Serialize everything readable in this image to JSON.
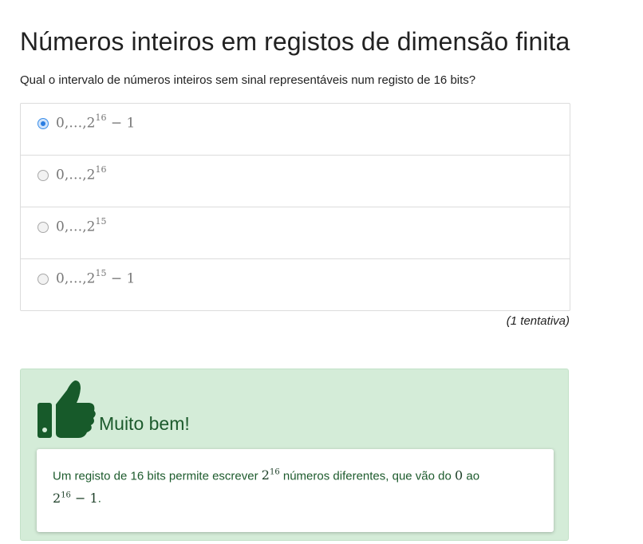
{
  "page": {
    "title": "Números inteiros em registos de dimensão finita",
    "question": "Qual o intervalo de números inteiros sem sinal representáveis num registo de 16 bits?"
  },
  "options": [
    {
      "base": "0,…,2",
      "exp": "16",
      "suffix": " − 1",
      "selected": true
    },
    {
      "base": "0,…,2",
      "exp": "16",
      "suffix": "",
      "selected": false
    },
    {
      "base": "0,…,2",
      "exp": "15",
      "suffix": "",
      "selected": false
    },
    {
      "base": "0,…,2",
      "exp": "15",
      "suffix": " − 1",
      "selected": false
    }
  ],
  "attempts_text": "(1 tentativa)",
  "feedback": {
    "icon": "thumbs-up-icon",
    "title": "Muito bem!",
    "text_part1": "Um registo de 16 bits permite escrever ",
    "math_base": "2",
    "math_exp": "16",
    "text_part2": " números diferentes, que vão do ",
    "zero": "0",
    "text_part3": " ao",
    "end_base": "2",
    "end_exp": "16",
    "end_suffix": " − 1",
    "period": "."
  },
  "colors": {
    "feedback_bg": "#d4ecd8",
    "feedback_text": "#1d5b2d",
    "radio_selected": "#2a7de1"
  }
}
